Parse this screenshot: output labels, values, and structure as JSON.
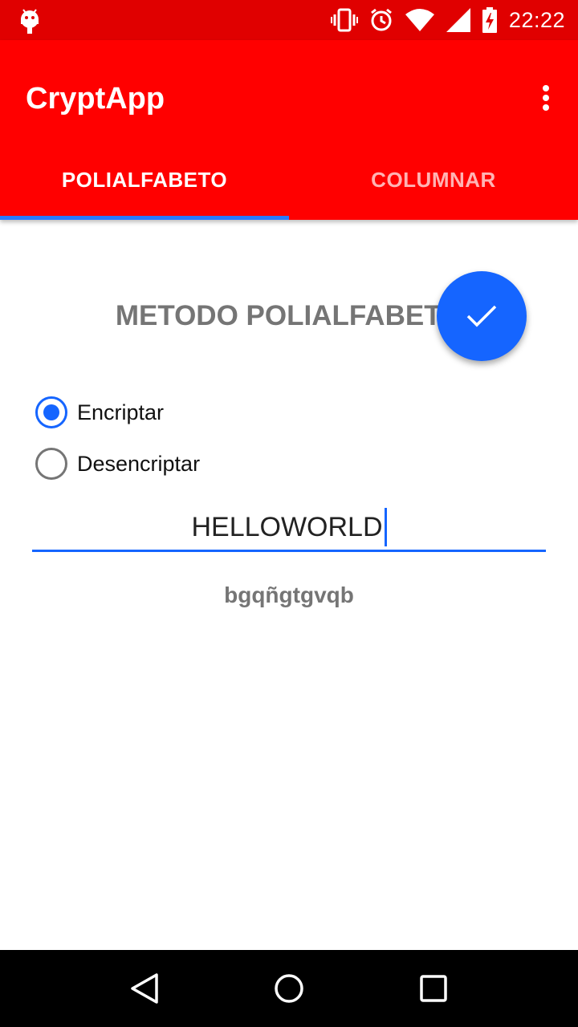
{
  "status_bar": {
    "time": "22:22",
    "icons": [
      "android-icon",
      "vibrate-icon",
      "alarm-icon",
      "wifi-icon",
      "signal-icon",
      "battery-charging-icon"
    ]
  },
  "app_bar": {
    "title": "CryptApp",
    "overflow_icon": "more-vert-icon",
    "tabs": [
      {
        "label": "POLIALFABETO",
        "active": true
      },
      {
        "label": "COLUMNAR",
        "active": false
      }
    ],
    "colors": {
      "primary": "#ff0000",
      "status": "#e00000",
      "accent": "#1565ff"
    }
  },
  "main": {
    "method_title": "METODO POLIALFABETO",
    "fab_icon": "check-icon",
    "options": [
      {
        "label": "Encriptar",
        "checked": true
      },
      {
        "label": "Desencriptar",
        "checked": false
      }
    ],
    "input_value": "HELLOWORLD",
    "result": "bgqñgtgvqb"
  },
  "nav_bar": {
    "icons": [
      "back-icon",
      "home-icon",
      "recents-icon"
    ]
  }
}
